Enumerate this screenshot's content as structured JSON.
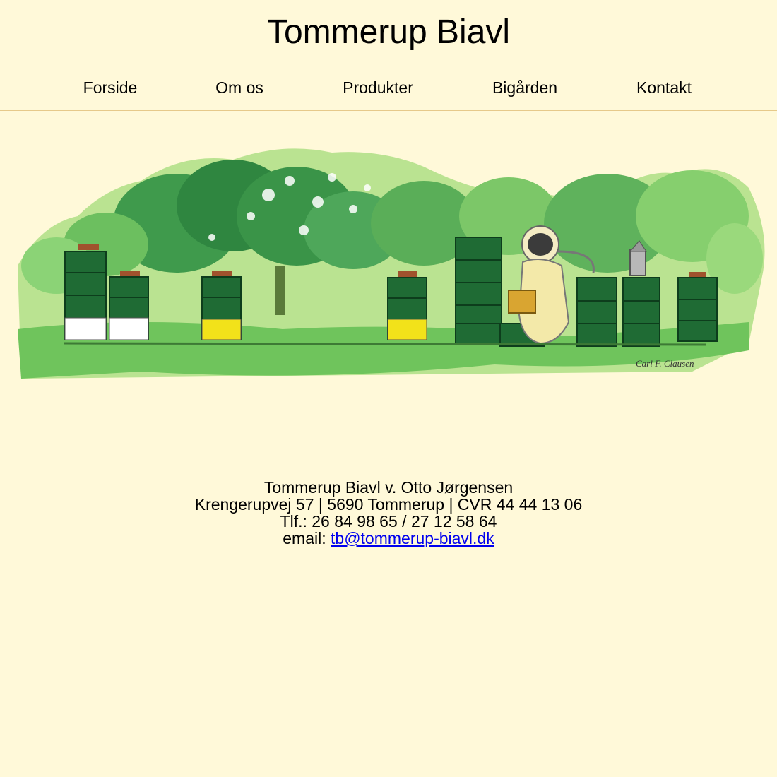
{
  "site": {
    "title": "Tommerup Biavl"
  },
  "nav": {
    "items": [
      {
        "id": "forside",
        "label": "Forside"
      },
      {
        "id": "om-os",
        "label": "Om os"
      },
      {
        "id": "produkter",
        "label": "Produkter"
      },
      {
        "id": "bigaarden",
        "label": "Bigården"
      },
      {
        "id": "kontakt",
        "label": "Kontakt"
      }
    ]
  },
  "hero": {
    "image": "watercolor-apiary-illustration",
    "signature": "Carl F. Clausen"
  },
  "footer": {
    "line1": "Tommerup Biavl v. Otto Jørgensen",
    "line2": "Krengerupvej 57 | 5690 Tommerup | CVR 44 44 13 06",
    "line3": "Tlf.: 26 84 98 65 / 27 12 58 64",
    "email_prefix": "email: ",
    "email": "tb@tommerup-biavl.dk"
  },
  "colors": {
    "background": "#fff9d9",
    "divider": "#e6c98a",
    "hive_green": "#1f6b34",
    "link": "#0000ee"
  }
}
